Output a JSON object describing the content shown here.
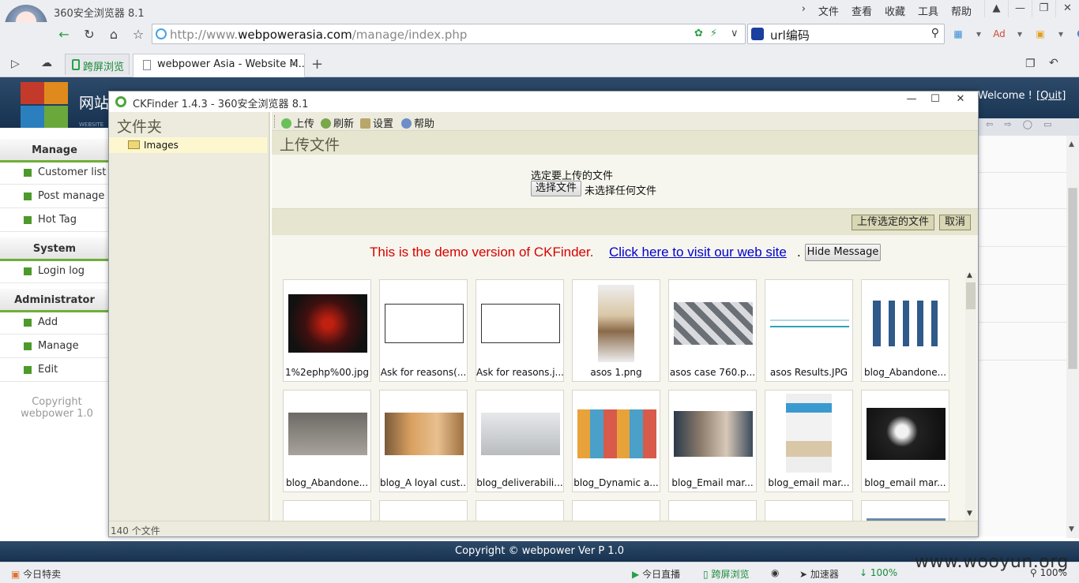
{
  "browser": {
    "title": "360安全浏览器 8.1",
    "menu": [
      "文件",
      "查看",
      "收藏",
      "工具",
      "帮助"
    ],
    "url": {
      "prefix": "http://www.",
      "domain": "webpowerasia.com",
      "path": "/manage/index.php"
    },
    "search_text": "url编码",
    "tabs": [
      {
        "label": "跨屏浏览"
      },
      {
        "label": "webpower Asia - Website M..."
      }
    ]
  },
  "site": {
    "name": "网站",
    "sub": "WEBSITE",
    "welcome": "Welcome !",
    "quit": "[Quit]",
    "menu": {
      "manage_head": "Manage",
      "manage_items": [
        "Customer list",
        "Post manage",
        "Hot Tag"
      ],
      "system_head": "System",
      "system_items": [
        "Login log"
      ],
      "admin_head": "Administrator",
      "admin_items": [
        "Add",
        "Manage",
        "Edit"
      ]
    },
    "copyright_left": "Copyright webpower 1.0",
    "footer": "Copyright © webpower Ver P 1.0"
  },
  "ckfinder": {
    "window_title": "CKFinder 1.4.3 - 360安全浏览器 8.1",
    "folders_title": "文件夹",
    "folder_name": "Images",
    "toolbar": {
      "upload": "上传",
      "refresh": "刷新",
      "settings": "设置",
      "help": "帮助"
    },
    "upload_title": "上传文件",
    "upload_label": "选定要上传的文件",
    "choose_file": "选择文件",
    "no_file": "未选择任何文件",
    "upload_selected": "上传选定的文件",
    "cancel": "取消",
    "demo_text": "This is the demo version of CKFinder.",
    "demo_link": "Click here to visit our web site",
    "demo_dot": ".",
    "hide_message": "Hide Message",
    "files": [
      "1%2ephp%00.jpg",
      "Ask for reasons(...",
      "Ask for reasons.j...",
      "asos 1.png",
      "asos case 760.p...",
      "asos Results.JPG",
      "blog_Abandone...",
      "blog_Abandone...",
      "blog_A loyal cust...",
      "blog_deliverabili...",
      "blog_Dynamic a...",
      "blog_Email mar...",
      "blog_email mar...",
      "blog_email mar..."
    ],
    "status": "140 个文件"
  },
  "statusbar": {
    "left": "今日特卖",
    "live": "今日直播",
    "split": "跨屏浏览",
    "accel": "加速器",
    "download": "100%",
    "zoom": "100%"
  },
  "watermark": "www.wooyun.org",
  "colors": {
    "ckfinder_bg": "#ecebdd",
    "demo_red": "#d80000",
    "link_blue": "#0000cc",
    "header_blue": "#1e3a5c",
    "menu_green": "#6fae3a"
  }
}
